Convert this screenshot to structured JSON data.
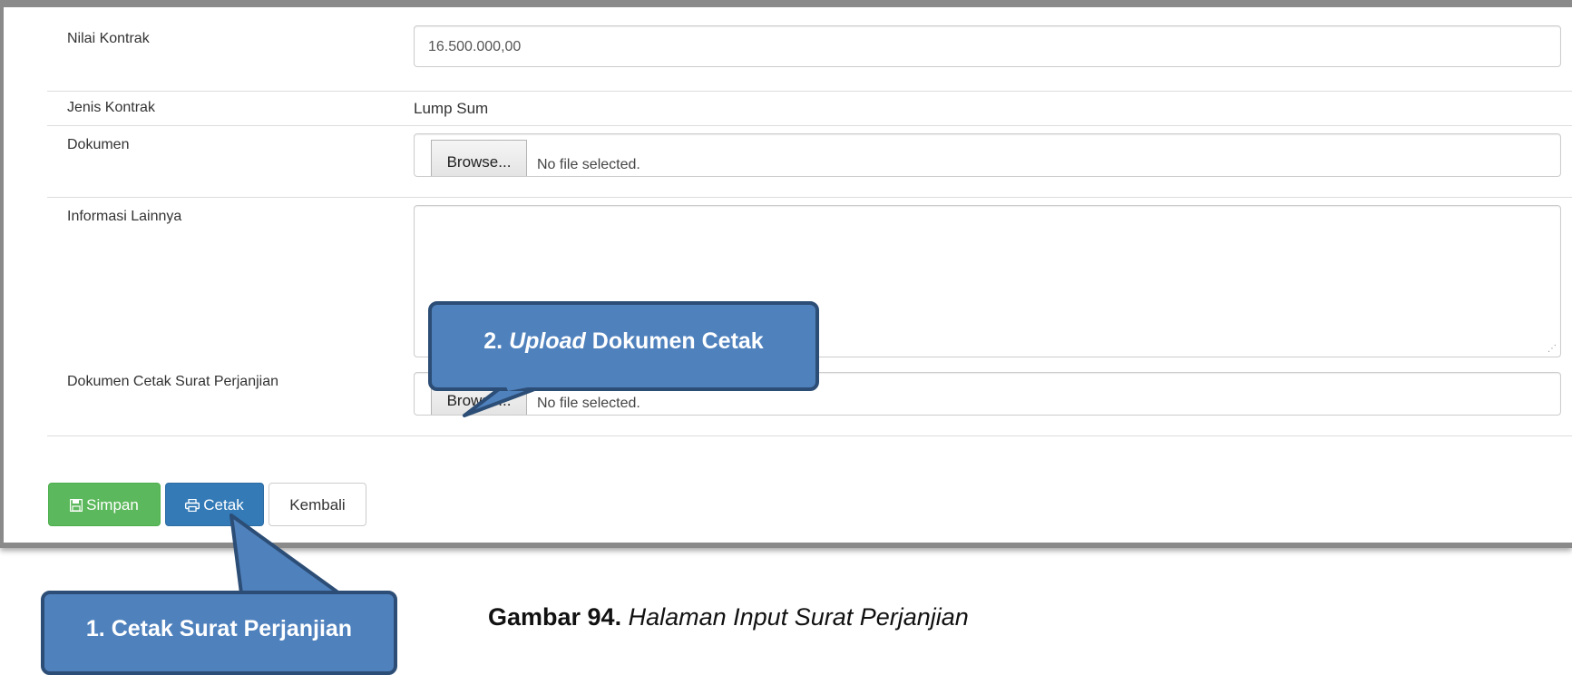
{
  "form": {
    "nilai_kontrak": {
      "label": "Nilai Kontrak",
      "value": "16.500.000,00"
    },
    "jenis_kontrak": {
      "label": "Jenis Kontrak",
      "value": "Lump Sum"
    },
    "dokumen": {
      "label": "Dokumen",
      "browse_label": "Browse...",
      "status": "No file selected."
    },
    "informasi_lainnya": {
      "label": "Informasi Lainnya",
      "value": ""
    },
    "dokumen_cetak": {
      "label": "Dokumen Cetak Surat Perjanjian",
      "browse_label": "Browse...",
      "status": "No file selected."
    }
  },
  "buttons": {
    "simpan": {
      "label": "Simpan",
      "icon": "floppy-disk-icon",
      "color": "#5cb85c"
    },
    "cetak": {
      "label": "Cetak",
      "icon": "printer-icon",
      "color": "#337ab7"
    },
    "kembali": {
      "label": "Kembali"
    }
  },
  "callouts": {
    "upload": {
      "number": "2.",
      "italic": "Upload",
      "rest": "Dokumen Cetak"
    },
    "cetak": {
      "text": "1. Cetak Surat Perjanjian"
    }
  },
  "caption": {
    "bold": "Gambar 94.",
    "italic": "Halaman Input Surat Perjanjian"
  },
  "colors": {
    "callout_fill": "#4f81bd",
    "callout_border": "#2c4d75"
  }
}
